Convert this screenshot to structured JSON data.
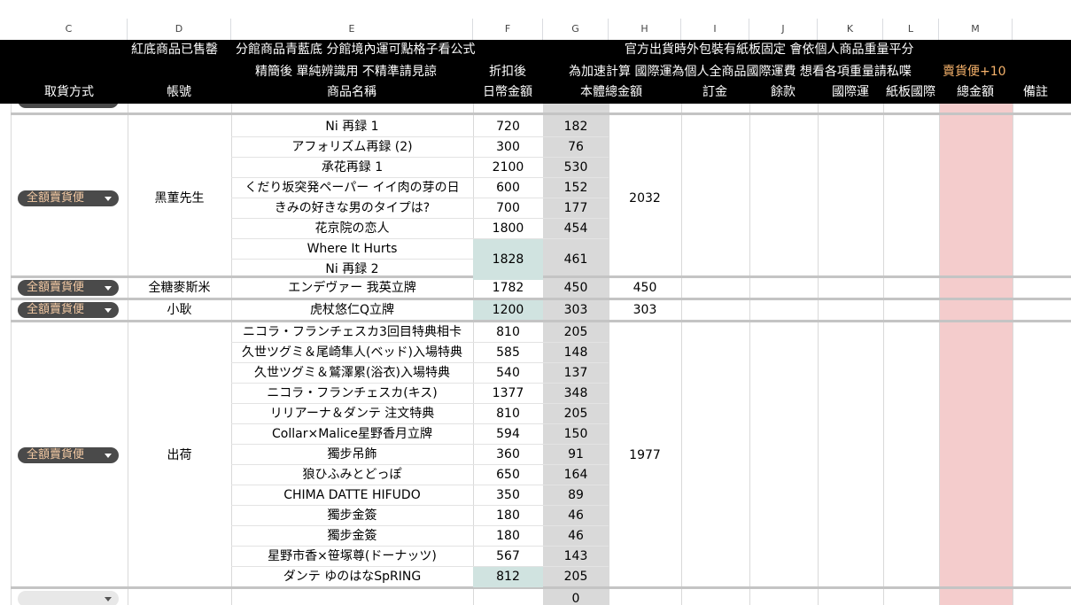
{
  "columns": [
    "C",
    "D",
    "E",
    "F",
    "G",
    "H",
    "I",
    "J",
    "K",
    "L",
    "M"
  ],
  "header": {
    "row1_d": "紅底商品已售罄",
    "row1_e": "分館商品青藍底 分館境內運可點格子看公式",
    "row1_h": "官方出貨時外包裝有紙板固定 會依個人商品重量平分",
    "row2_e": "精簡後 單純辨識用 不精準請見諒",
    "row2_f": "折扣後",
    "row2_h": "為加速計算 國際運為個人全商品國際運費 想看各項重量請私喋",
    "row2_m": "賣貨便+10",
    "labels": {
      "c": "取貨方式",
      "d": "帳號",
      "e": "商品名稱",
      "f": "日幣金額",
      "g": "本體總金額",
      "i": "訂金",
      "j": "餘款",
      "k": "國際運",
      "l": "紙板國際",
      "m": "總金額",
      "n": "備註"
    }
  },
  "chip_label": "全額賣貨便",
  "groups": [
    {
      "account": "黑菫先生",
      "total": "2032",
      "items": [
        {
          "name": "Ni 再録 1",
          "jpy": "720",
          "body": "182"
        },
        {
          "name": "アフォリズム再録 (2)",
          "jpy": "300",
          "body": "76"
        },
        {
          "name": "承花再録 1",
          "jpy": "2100",
          "body": "530"
        },
        {
          "name": "くだり坂突発ペーパー イイ肉の芽の日",
          "jpy": "600",
          "body": "152"
        },
        {
          "name": "きみの好きな男のタイプは?",
          "jpy": "700",
          "body": "177"
        },
        {
          "name": "花京院の恋人",
          "jpy": "1800",
          "body": "454"
        }
      ],
      "merged": {
        "names": [
          "Where It Hurts",
          "Ni 再録 2"
        ],
        "jpy": "1828",
        "body": "461"
      }
    },
    {
      "account": "全糖麥斯米",
      "total": "450",
      "items": [
        {
          "name": "エンデヴァー 我英立牌",
          "jpy": "1782",
          "body": "450"
        }
      ]
    },
    {
      "account": "小耿",
      "total": "303",
      "items": [
        {
          "name": "虎杖悠仁Q立牌",
          "jpy": "1200",
          "body": "303",
          "teal": true
        }
      ]
    },
    {
      "account": "出荷",
      "total": "1977",
      "items": [
        {
          "name": "ニコラ・フランチェスカ3回目特典相卡",
          "jpy": "810",
          "body": "205"
        },
        {
          "name": "久世ツグミ＆尾崎隼人(ベッド)入場特典",
          "jpy": "585",
          "body": "148"
        },
        {
          "name": "久世ツグミ＆鷲澤累(浴衣)入場特典",
          "jpy": "540",
          "body": "137"
        },
        {
          "name": "ニコラ・フランチェスカ(キス)",
          "jpy": "1377",
          "body": "348"
        },
        {
          "name": "リリアーナ＆ダンテ 注文特典",
          "jpy": "810",
          "body": "205"
        },
        {
          "name": "Collar×Malice星野香月立牌",
          "jpy": "594",
          "body": "150"
        },
        {
          "name": "獨步吊飾",
          "jpy": "360",
          "body": "91"
        },
        {
          "name": "狼ひふみとどっぽ",
          "jpy": "650",
          "body": "164"
        },
        {
          "name": "CHIMA DATTE HIFUDO",
          "jpy": "350",
          "body": "89"
        },
        {
          "name": "獨步金簽",
          "jpy": "180",
          "body": "46"
        },
        {
          "name": "獨步金簽",
          "jpy": "180",
          "body": "46"
        },
        {
          "name": "星野市香×笹塚尊(ドーナッツ)",
          "jpy": "567",
          "body": "143"
        },
        {
          "name": "ダンテ ゆのはなSpRING",
          "jpy": "812",
          "body": "205",
          "teal": true
        }
      ]
    }
  ],
  "last_row": {
    "body": "0"
  }
}
